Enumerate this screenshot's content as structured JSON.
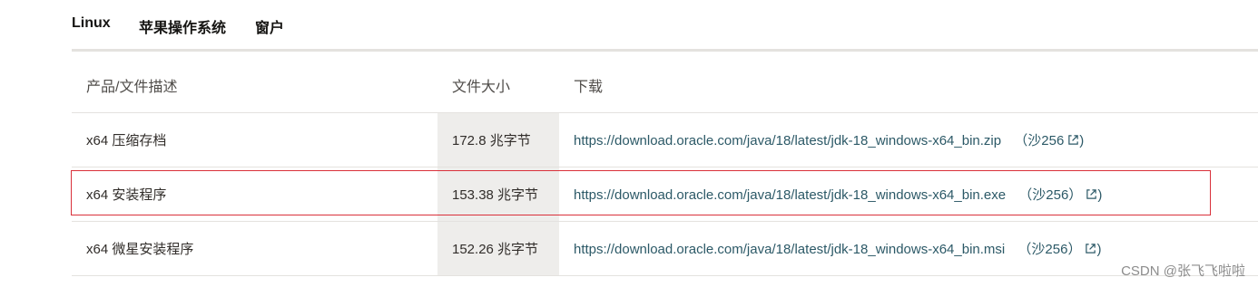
{
  "tabs": [
    "Linux",
    "苹果操作系统",
    "窗户"
  ],
  "active_tab_index": 2,
  "table": {
    "headers": [
      "产品/文件描述",
      "文件大小",
      "下载"
    ],
    "rows": [
      {
        "desc": "x64 压缩存档",
        "size": "172.8 兆字节",
        "url": "https://download.oracle.com/java/18/latest/jdk-18_windows-x64_bin.zip",
        "checksum": "（沙256",
        "close": ")"
      },
      {
        "desc": "x64 安装程序",
        "size": "153.38 兆字节",
        "url": "https://download.oracle.com/java/18/latest/jdk-18_windows-x64_bin.exe",
        "checksum": "（沙256）",
        "close": ")"
      },
      {
        "desc": "x64 微星安装程序",
        "size": "152.26 兆字节",
        "url": "https://download.oracle.com/java/18/latest/jdk-18_windows-x64_bin.msi",
        "checksum": "（沙256）",
        "close": ")"
      }
    ]
  },
  "highlighted_row_index": 1,
  "watermark": "CSDN @张飞飞啦啦",
  "colors": {
    "accent": "#4c6a58",
    "link": "#2c5967",
    "highlight": "#d9303a"
  }
}
